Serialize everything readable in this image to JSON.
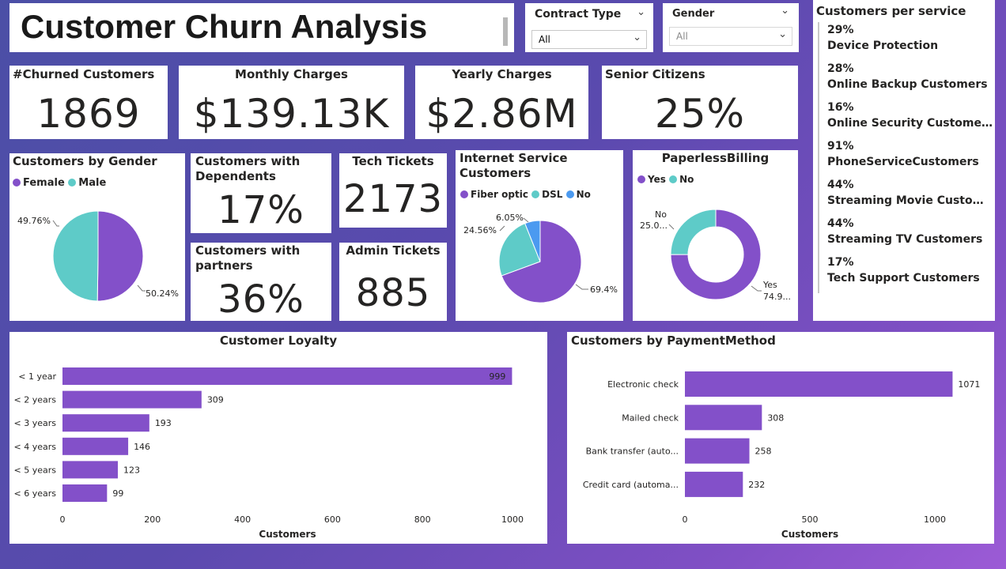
{
  "title": "Customer Churn Analysis",
  "slicers": [
    {
      "title": "Contract Type",
      "value": "All"
    },
    {
      "title": "Gender",
      "value": "All"
    }
  ],
  "kpis": {
    "churned": {
      "label": "#Churned Customers",
      "value": "1869"
    },
    "monthly": {
      "label": "Monthly Charges",
      "value": "$139.13K"
    },
    "yearly": {
      "label": "Yearly Charges",
      "value": "$2.86M"
    },
    "senior": {
      "label": "Senior Citizens",
      "value": "25%"
    },
    "dependents": {
      "label": "Customers with Dependents",
      "value": "17%"
    },
    "partners": {
      "label": "Customers with partners",
      "value": "36%"
    },
    "tech": {
      "label": "Tech Tickets",
      "value": "2173"
    },
    "admin": {
      "label": "Admin Tickets",
      "value": "885"
    }
  },
  "services": {
    "title": "Customers per service",
    "items": [
      {
        "pct": "29%",
        "name": "Device Protection"
      },
      {
        "pct": "28%",
        "name": "Online Backup Customers"
      },
      {
        "pct": "16%",
        "name": "Online Security Customers"
      },
      {
        "pct": "91%",
        "name": "PhoneServiceCustomers"
      },
      {
        "pct": "44%",
        "name": "Streaming Movie Custom…"
      },
      {
        "pct": "44%",
        "name": "Streaming TV Customers"
      },
      {
        "pct": "17%",
        "name": "Tech Support Customers"
      }
    ]
  },
  "colors": {
    "purple": "#8350c9",
    "teal": "#5ecbc8",
    "blue": "#4b9af0",
    "bar": "#8350c9"
  },
  "chart_data": [
    {
      "type": "pie",
      "title": "Customers by Gender",
      "labels": [
        "Female",
        "Male"
      ],
      "values": [
        50.24,
        49.76
      ],
      "data_labels": [
        "50.24%",
        "49.76%"
      ]
    },
    {
      "type": "pie",
      "title": "Internet Service Customers",
      "labels": [
        "Fiber optic",
        "DSL",
        "No"
      ],
      "values": [
        69.4,
        24.56,
        6.05
      ],
      "data_labels": [
        "69.4%",
        "24.56%",
        "6.05%"
      ]
    },
    {
      "type": "pie",
      "title": "PaperlessBilling",
      "labels": [
        "Yes",
        "No"
      ],
      "values": [
        74.9,
        25.0
      ],
      "data_labels": [
        "Yes",
        "No"
      ],
      "data_values": [
        "74.9...",
        "25.0..."
      ]
    },
    {
      "type": "bar",
      "title": "Customer Loyalty",
      "categories": [
        "< 1 year",
        "< 2 years",
        "< 3 years",
        "< 4 years",
        "< 5 years",
        "< 6 years"
      ],
      "values": [
        999,
        309,
        193,
        146,
        123,
        99
      ],
      "xlabel": "Customers",
      "xticks": [
        "0",
        "200",
        "400",
        "600",
        "800",
        "1000"
      ],
      "xlim": [
        0,
        1000
      ]
    },
    {
      "type": "bar",
      "title": "Customers by PaymentMethod",
      "categories": [
        "Electronic check",
        "Mailed check",
        "Bank transfer (auto...",
        "Credit card (automa..."
      ],
      "values": [
        1071,
        308,
        258,
        232
      ],
      "xlabel": "Customers",
      "xticks": [
        "0",
        "500",
        "1000"
      ],
      "xlim": [
        0,
        1000
      ]
    }
  ]
}
